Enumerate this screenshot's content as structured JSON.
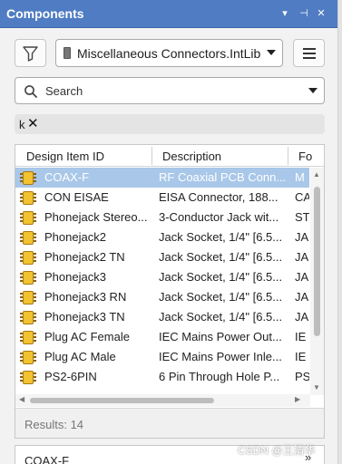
{
  "panel": {
    "title": "Components",
    "controls": {
      "menu_icon": "▾",
      "pin_icon": "⊣",
      "close_icon": "✕"
    }
  },
  "toolbar": {
    "library_selected": "Miscellaneous Connectors.IntLib",
    "filter_icon": "funnel-icon",
    "menu_icon": "hamburger-menu-icon"
  },
  "search": {
    "label": "Search",
    "icon": "magnifier-icon"
  },
  "filter_chip": {
    "text": "k",
    "clear_glyph": "✕"
  },
  "grid": {
    "columns": [
      "Design Item ID",
      "Description",
      "Fo"
    ],
    "rows": [
      {
        "id": "COAX-F",
        "description": "RF Coaxial PCB Conn...",
        "footprint": "M",
        "selected": true
      },
      {
        "id": "CON EISAE",
        "description": "EISA Connector, 188...",
        "footprint": "CA"
      },
      {
        "id": "Phonejack Stereo...",
        "description": "3-Conductor Jack wit...",
        "footprint": "ST"
      },
      {
        "id": "Phonejack2",
        "description": "Jack Socket, 1/4\" [6.5...",
        "footprint": "JA"
      },
      {
        "id": "Phonejack2 TN",
        "description": "Jack Socket, 1/4\" [6.5...",
        "footprint": "JA"
      },
      {
        "id": "Phonejack3",
        "description": "Jack Socket, 1/4\" [6.5...",
        "footprint": "JA"
      },
      {
        "id": "Phonejack3 RN",
        "description": "Jack Socket, 1/4\" [6.5...",
        "footprint": "JA"
      },
      {
        "id": "Phonejack3 TN",
        "description": "Jack Socket, 1/4\" [6.5...",
        "footprint": "JA"
      },
      {
        "id": "Plug AC Female",
        "description": "IEC Mains Power Out...",
        "footprint": "IE"
      },
      {
        "id": "Plug AC Male",
        "description": "IEC Mains Power Inle...",
        "footprint": "IE"
      },
      {
        "id": "PS2-6PIN",
        "description": "6 Pin Through Hole P...",
        "footprint": "PS"
      },
      {
        "id": "",
        "description": "",
        "footprint": ""
      }
    ],
    "results_label": "Results: 14"
  },
  "detail": {
    "title": "COAX-F",
    "collapse_glyph": "»"
  },
  "watermark": "CSDN @王清华",
  "colors": {
    "header_bg": "#4f7cc3",
    "selected_row": "#a9c7e8",
    "chip_icon": "#f2c230"
  }
}
